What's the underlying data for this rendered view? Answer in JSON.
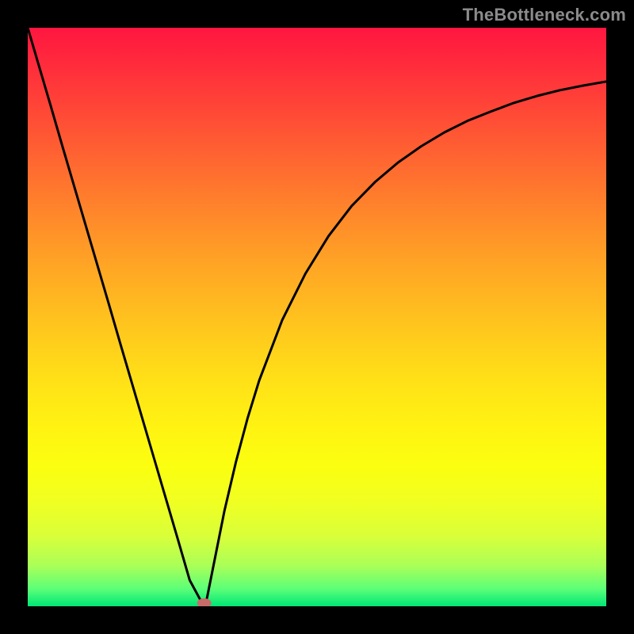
{
  "watermark": "TheBottleneck.com",
  "chart_data": {
    "type": "line",
    "x": [
      0.0,
      0.02,
      0.04,
      0.06,
      0.08,
      0.1,
      0.12,
      0.14,
      0.16,
      0.18,
      0.2,
      0.22,
      0.24,
      0.26,
      0.28,
      0.3,
      0.305,
      0.31,
      0.32,
      0.34,
      0.36,
      0.38,
      0.4,
      0.44,
      0.48,
      0.52,
      0.56,
      0.6,
      0.64,
      0.68,
      0.72,
      0.76,
      0.8,
      0.84,
      0.88,
      0.92,
      0.96,
      1.0
    ],
    "y": [
      1.0,
      0.932,
      0.864,
      0.795,
      0.727,
      0.659,
      0.591,
      0.523,
      0.454,
      0.386,
      0.318,
      0.25,
      0.182,
      0.114,
      0.045,
      0.008,
      0.0,
      0.015,
      0.065,
      0.165,
      0.25,
      0.325,
      0.39,
      0.495,
      0.575,
      0.64,
      0.692,
      0.733,
      0.767,
      0.795,
      0.819,
      0.839,
      0.855,
      0.87,
      0.882,
      0.892,
      0.9,
      0.907
    ],
    "title": "",
    "xlabel": "",
    "ylabel": "",
    "xlim": [
      0,
      1
    ],
    "ylim": [
      0,
      1
    ],
    "minimum_marker": {
      "x": 0.305,
      "y": 0.0,
      "color": "#c96a6a"
    }
  }
}
